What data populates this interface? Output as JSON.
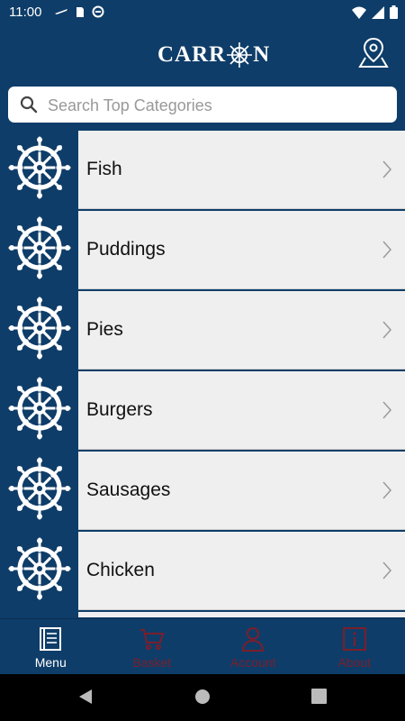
{
  "status": {
    "time": "11:00"
  },
  "header": {
    "logo_text_left": "CARR",
    "logo_text_right": "N"
  },
  "search": {
    "placeholder": "Search Top Categories"
  },
  "categories": [
    {
      "label": "Fish"
    },
    {
      "label": "Puddings"
    },
    {
      "label": "Pies"
    },
    {
      "label": "Burgers"
    },
    {
      "label": "Sausages"
    },
    {
      "label": "Chicken"
    }
  ],
  "tabs": [
    {
      "label": "Menu",
      "icon": "book-icon",
      "color": "#ffffff",
      "active": true
    },
    {
      "label": "Basket",
      "icon": "cart-icon",
      "color": "#7a1f2b",
      "active": false
    },
    {
      "label": "Account",
      "icon": "person-icon",
      "color": "#7a1f2b",
      "active": false
    },
    {
      "label": "About",
      "icon": "info-icon",
      "color": "#7a1f2b",
      "active": false
    }
  ],
  "colors": {
    "brand": "#0f3d69",
    "row_bg": "#efefef",
    "inactive_tab": "#7a1f2b"
  }
}
